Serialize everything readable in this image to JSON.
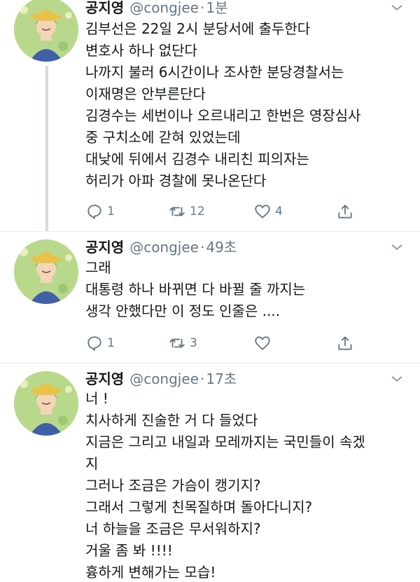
{
  "tweets": [
    {
      "name": "공지영",
      "handle": "@congjee",
      "separator": "·",
      "time": "1분",
      "lines": [
        "김부선은 22일 2시 분당서에 출두한다",
        "변호사 하나 없단다",
        "나까지 불러 6시간이나 조사한 분당경찰서는",
        "이재명은 안부른단다",
        "김경수는 세번이나 오르내리고 한번은 영장심사",
        "중 구치소에 갇혀 있었는데",
        "대낮에 뒤에서 김경수 내리친 피의자는",
        "허리가 아파 경찰에 못나온단다"
      ],
      "reply_count": "1",
      "retweet_count": "12",
      "like_count": "4"
    },
    {
      "name": "공지영",
      "handle": "@congjee",
      "separator": "·",
      "time": "49초",
      "lines": [
        "그래",
        "대통령 하나 바뀌면 다 바뀔 줄 까지는",
        "생각 안했다만 이 정도 인줄은 ...."
      ],
      "reply_count": "1",
      "retweet_count": "3",
      "like_count": ""
    },
    {
      "name": "공지영",
      "handle": "@congjee",
      "separator": "·",
      "time": "17초",
      "lines": [
        "너 !",
        "치사하게 진술한 거 다 들었다",
        "지금은 그리고 내일과 모레까지는 국민들이 속겠",
        "지",
        "그러나 조금은 가슴이 캥기지?",
        "그래서 그렇게 친목질하며 돌아다니지?",
        "너 하늘을 조금은 무서워하지?",
        "거울 좀 봐 !!!!",
        "흉하게 변해가는 모습!"
      ]
    }
  ],
  "icons": {
    "reply": "speech-bubble-icon",
    "retweet": "retweet-arrows-icon",
    "like": "heart-outline-icon",
    "share": "share-upload-icon",
    "more": "chevron-down-icon"
  },
  "colors": {
    "text": "#14171a",
    "secondary": "#657786",
    "divider": "#e6ecf0",
    "thread_line": "#d4dbe0"
  }
}
